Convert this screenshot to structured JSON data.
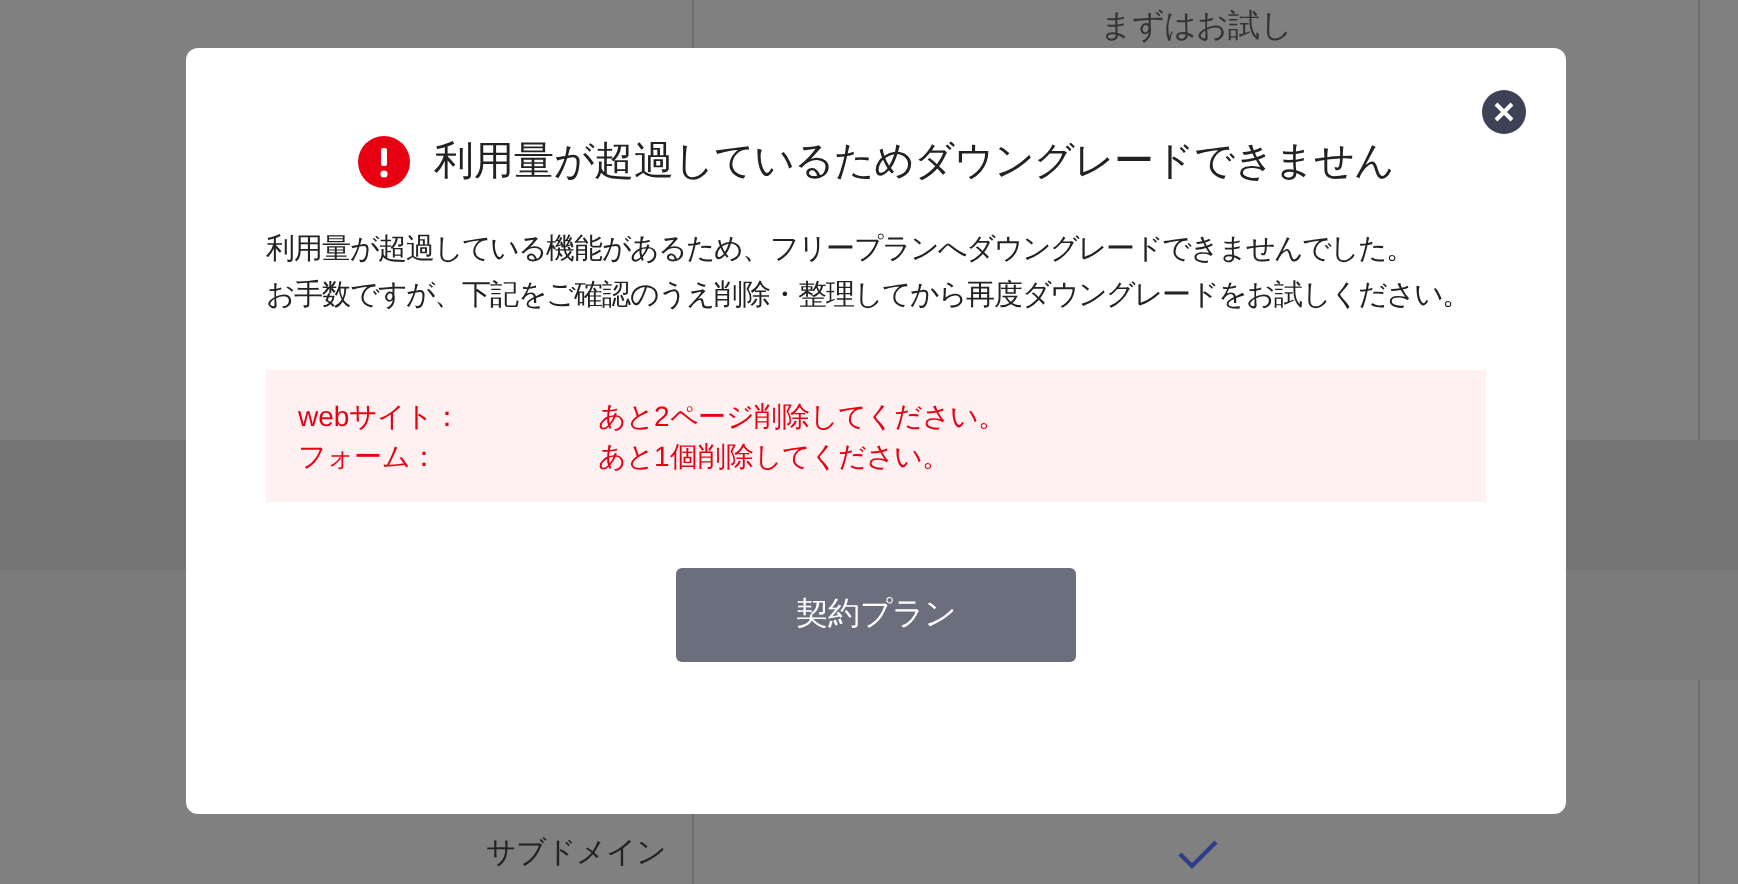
{
  "background": {
    "header_text": "まずはお試し",
    "rows": [
      {
        "label": "サブドメイン",
        "checked": true
      }
    ]
  },
  "dialog": {
    "title": "利用量が超過しているためダウングレードできません",
    "message": [
      "利用量が超過している機能があるため、フリープランへダウングレードできませんでした。",
      "お手数ですが、下記をご確認のうえ削除・整理してから再度ダウングレードをお試しください。"
    ],
    "items": [
      {
        "label": "webサイト：",
        "value": "あと2ページ削除してください。"
      },
      {
        "label": "フォーム：",
        "value": "あと1個削除してください。"
      }
    ],
    "button": "契約プラン"
  }
}
